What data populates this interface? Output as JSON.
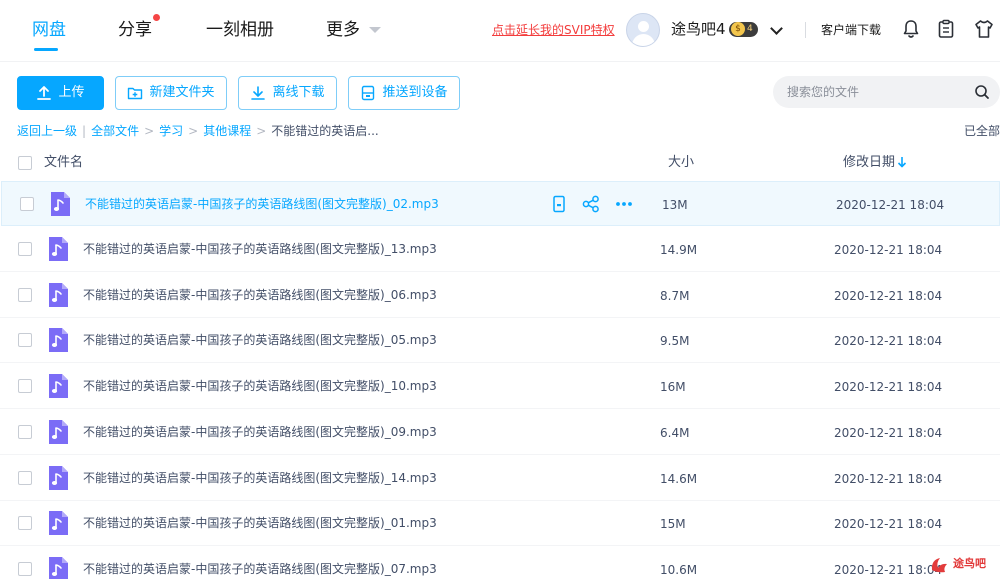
{
  "nav": {
    "tabs": [
      {
        "label": "网盘",
        "active": true
      },
      {
        "label": "分享",
        "has_dot": true
      },
      {
        "label": "一刻相册"
      },
      {
        "label": "更多"
      }
    ],
    "svip_link": "点击延长我的SVIP特权",
    "username": "途鸟吧4",
    "vip_badge": "4",
    "vip_coin": "$",
    "client_download": "客户端下载",
    "icons": [
      "bell-icon",
      "clipboard-icon",
      "shirt-icon"
    ]
  },
  "toolbar": {
    "upload": "上传",
    "new_folder": "新建文件夹",
    "offline_download": "离线下载",
    "push_to_device": "推送到设备"
  },
  "search": {
    "placeholder": "搜索您的文件"
  },
  "breadcrumb": {
    "back": "返回上一级",
    "items": [
      "全部文件",
      "学习",
      "其他课程"
    ],
    "current": "不能错过的英语启...",
    "status": "已全部"
  },
  "table": {
    "headers": {
      "name": "文件名",
      "size": "大小",
      "date": "修改日期"
    },
    "sort": "date-desc",
    "rows": [
      {
        "name": "不能错过的英语启蒙-中国孩子的英语路线图(图文完整版)_02.mp3",
        "size": "13M",
        "date": "2020-12-21 18:04",
        "hover": true
      },
      {
        "name": "不能错过的英语启蒙-中国孩子的英语路线图(图文完整版)_13.mp3",
        "size": "14.9M",
        "date": "2020-12-21 18:04"
      },
      {
        "name": "不能错过的英语启蒙-中国孩子的英语路线图(图文完整版)_06.mp3",
        "size": "8.7M",
        "date": "2020-12-21 18:04"
      },
      {
        "name": "不能错过的英语启蒙-中国孩子的英语路线图(图文完整版)_05.mp3",
        "size": "9.5M",
        "date": "2020-12-21 18:04"
      },
      {
        "name": "不能错过的英语启蒙-中国孩子的英语路线图(图文完整版)_10.mp3",
        "size": "16M",
        "date": "2020-12-21 18:04"
      },
      {
        "name": "不能错过的英语启蒙-中国孩子的英语路线图(图文完整版)_09.mp3",
        "size": "6.4M",
        "date": "2020-12-21 18:04"
      },
      {
        "name": "不能错过的英语启蒙-中国孩子的英语路线图(图文完整版)_14.mp3",
        "size": "14.6M",
        "date": "2020-12-21 18:04"
      },
      {
        "name": "不能错过的英语启蒙-中国孩子的英语路线图(图文完整版)_01.mp3",
        "size": "15M",
        "date": "2020-12-21 18:04"
      },
      {
        "name": "不能错过的英语启蒙-中国孩子的英语路线图(图文完整版)_07.mp3",
        "size": "10.6M",
        "date": "2020-12-21 18:04"
      }
    ],
    "row_actions": [
      "device-icon",
      "share-icon",
      "more-icon"
    ]
  },
  "watermark": "途鸟吧",
  "colors": {
    "accent": "#06a7ff",
    "svip_red": "#f33d3d",
    "file_icon": "#7b6cf6",
    "hover_row": "#f0f9fe"
  }
}
